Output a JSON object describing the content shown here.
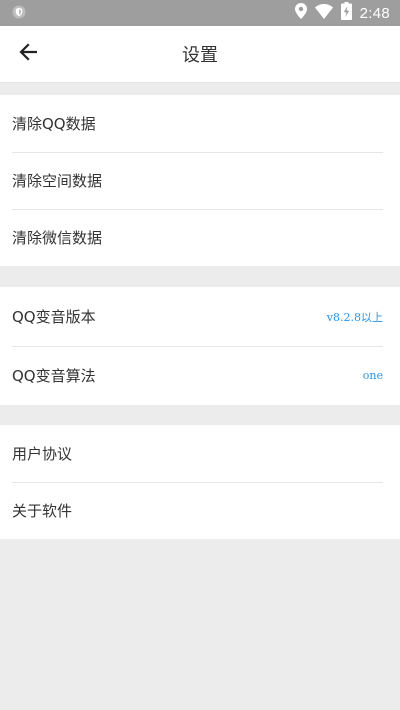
{
  "status_bar": {
    "time": "2:48",
    "icons": [
      "shield-icon",
      "location-icon",
      "wifi-icon",
      "battery-charging-icon"
    ]
  },
  "toolbar": {
    "back_icon": "arrow-left-icon",
    "title": "设置"
  },
  "section_data": {
    "items": [
      {
        "label": "清除QQ数据"
      },
      {
        "label": "清除空间数据"
      },
      {
        "label": "清除微信数据"
      }
    ]
  },
  "section_version": {
    "items": [
      {
        "label": "QQ变音版本",
        "value": "v8.2.8以上"
      },
      {
        "label": "QQ变音算法",
        "value": "one"
      }
    ]
  },
  "section_about": {
    "items": [
      {
        "label": "用户协议"
      },
      {
        "label": "关于软件"
      }
    ]
  },
  "colors": {
    "status_bar": "#9e9e9e",
    "background": "#ececec",
    "accent_value": "#2196f3"
  }
}
